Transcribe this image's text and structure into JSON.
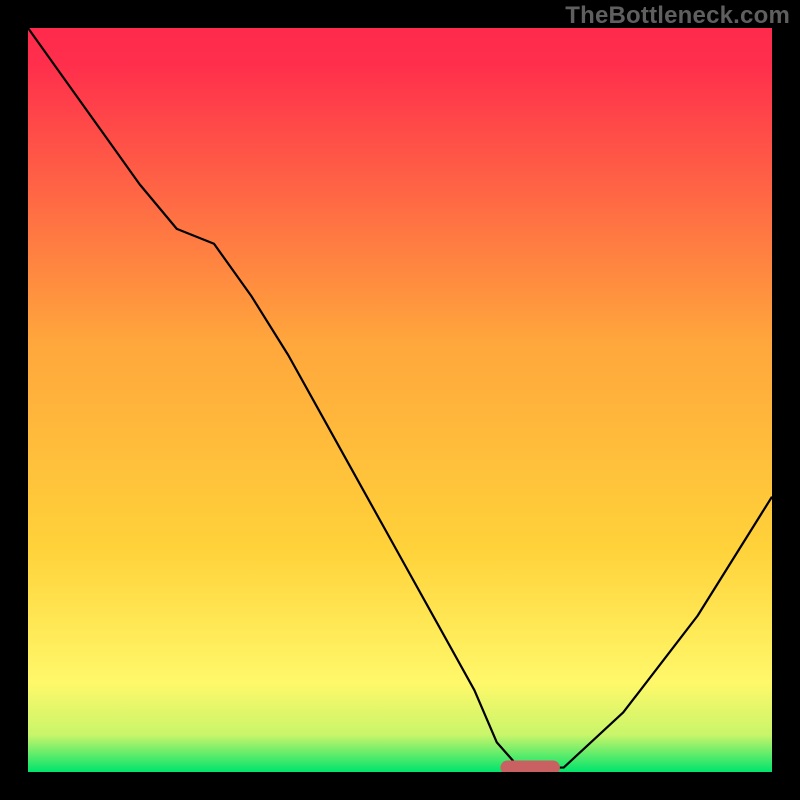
{
  "watermark": "TheBottleneck.com",
  "colors": {
    "outer_background": "#000000",
    "gradient_top": "#ff2a4c",
    "gradient_mid": "#ffd23a",
    "gradient_low": "#fff86a",
    "gradient_bottom": "#00e46c",
    "curve_stroke": "#000000",
    "marker_fill": "#c96061",
    "watermark_color": "#5f5f5f"
  },
  "chart_data": {
    "type": "line",
    "title": "",
    "xlabel": "",
    "ylabel": "",
    "xlim": [
      0,
      100
    ],
    "ylim": [
      0,
      100
    ],
    "x": [
      0,
      5,
      10,
      15,
      20,
      25,
      30,
      35,
      40,
      45,
      50,
      55,
      60,
      63,
      66,
      69,
      72,
      80,
      90,
      100
    ],
    "values": [
      100,
      93,
      86,
      79,
      73,
      71,
      64,
      56,
      47,
      38,
      29,
      20,
      11,
      4,
      0.6,
      0.6,
      0.6,
      8,
      21,
      37
    ],
    "marker": {
      "x_range": [
        63.5,
        71.5
      ],
      "y": 0.6,
      "shape": "capsule"
    },
    "gradient_stops": [
      {
        "offset": 0.0,
        "color": "#ff2a4c"
      },
      {
        "offset": 0.05,
        "color": "#ff2f4c"
      },
      {
        "offset": 0.42,
        "color": "#ffa63c"
      },
      {
        "offset": 0.7,
        "color": "#ffd23a"
      },
      {
        "offset": 0.88,
        "color": "#fff86a"
      },
      {
        "offset": 0.95,
        "color": "#c9f56a"
      },
      {
        "offset": 1.0,
        "color": "#00e46c"
      }
    ],
    "grid": false,
    "legend": false
  }
}
